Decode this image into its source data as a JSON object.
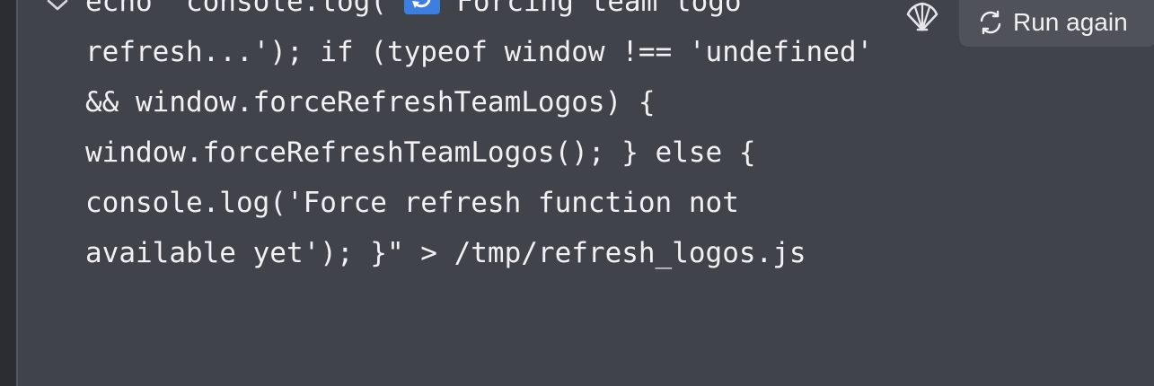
{
  "command": {
    "line1_before_emoji": "echo \"console.log('",
    "emoji_icon": "counterclockwise-arrows-button-icon",
    "line1_after_emoji": " Forcing team logo refresh...'); if (typeof window !== 'undefined' && window.forceRefreshTeamLogos) { window.forceRefreshTeamLogos(); } else { console.log('Force refresh function not available yet'); }\" > /tmp/refresh_logos.js"
  },
  "toolbar": {
    "run_again_label": "Run again",
    "refresh_icon": "refresh-icon",
    "shell_icon": "shell-icon"
  },
  "collapse": {
    "icon": "chevron-down-icon"
  }
}
